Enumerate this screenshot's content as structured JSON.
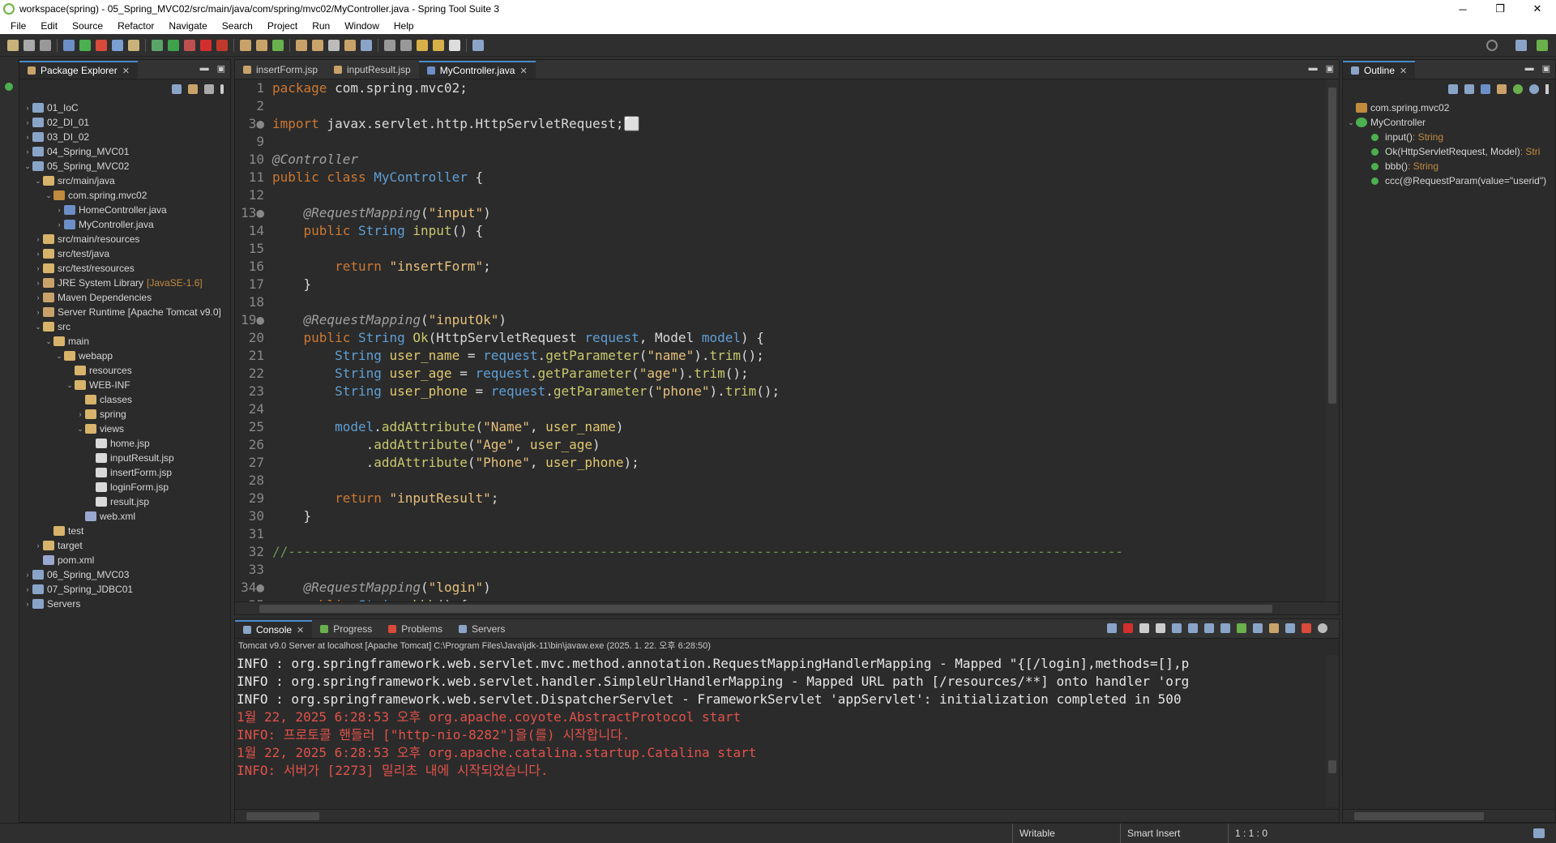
{
  "window": {
    "title": "workspace(spring) - 05_Spring_MVC02/src/main/java/com/spring/mvc02/MyController.java - Spring Tool Suite 3",
    "controls": [
      "─",
      "❐",
      "✕"
    ]
  },
  "menu": [
    "File",
    "Edit",
    "Source",
    "Refactor",
    "Navigate",
    "Search",
    "Project",
    "Run",
    "Window",
    "Help"
  ],
  "package_explorer": {
    "tab": "Package Explorer",
    "tree": [
      {
        "label": "01_IoC",
        "depth": 0,
        "arrow": "›",
        "color": "#8aa4c8"
      },
      {
        "label": "02_DI_01",
        "depth": 0,
        "arrow": "›",
        "color": "#8aa4c8"
      },
      {
        "label": "03_DI_02",
        "depth": 0,
        "arrow": "›",
        "color": "#8aa4c8"
      },
      {
        "label": "04_Spring_MVC01",
        "depth": 0,
        "arrow": "›",
        "color": "#8aa4c8"
      },
      {
        "label": "05_Spring_MVC02",
        "depth": 0,
        "arrow": "⌄",
        "color": "#8aa4c8"
      },
      {
        "label": "src/main/java",
        "depth": 1,
        "arrow": "⌄",
        "color": "#d7b36b"
      },
      {
        "label": "com.spring.mvc02",
        "depth": 2,
        "arrow": "⌄",
        "color": "#c08b3e"
      },
      {
        "label": "HomeController.java",
        "depth": 3,
        "arrow": "›",
        "color": "#6d8fc7"
      },
      {
        "label": "MyController.java",
        "depth": 3,
        "arrow": "›",
        "color": "#6d8fc7"
      },
      {
        "label": "src/main/resources",
        "depth": 1,
        "arrow": "›",
        "color": "#d7b36b"
      },
      {
        "label": "src/test/java",
        "depth": 1,
        "arrow": "›",
        "color": "#d7b36b"
      },
      {
        "label": "src/test/resources",
        "depth": 1,
        "arrow": "›",
        "color": "#d7b36b"
      },
      {
        "label": "JRE System Library",
        "deco": "[JavaSE-1.6]",
        "depth": 1,
        "arrow": "›",
        "color": "#c9a26a"
      },
      {
        "label": "Maven Dependencies",
        "depth": 1,
        "arrow": "›",
        "color": "#c9a26a"
      },
      {
        "label": "Server Runtime [Apache Tomcat v9.0]",
        "depth": 1,
        "arrow": "›",
        "color": "#c9a26a"
      },
      {
        "label": "src",
        "depth": 1,
        "arrow": "⌄",
        "color": "#d7b36b"
      },
      {
        "label": "main",
        "depth": 2,
        "arrow": "⌄",
        "color": "#d7b36b"
      },
      {
        "label": "webapp",
        "depth": 3,
        "arrow": "⌄",
        "color": "#d7b36b"
      },
      {
        "label": "resources",
        "depth": 4,
        "arrow": "",
        "color": "#d7b36b"
      },
      {
        "label": "WEB-INF",
        "depth": 4,
        "arrow": "⌄",
        "color": "#d7b36b"
      },
      {
        "label": "classes",
        "depth": 5,
        "arrow": "",
        "color": "#d7b36b"
      },
      {
        "label": "spring",
        "depth": 5,
        "arrow": "›",
        "color": "#d7b36b"
      },
      {
        "label": "views",
        "depth": 5,
        "arrow": "⌄",
        "color": "#d7b36b"
      },
      {
        "label": "home.jsp",
        "depth": 6,
        "arrow": "",
        "color": "#d9d9d9"
      },
      {
        "label": "inputResult.jsp",
        "depth": 6,
        "arrow": "",
        "color": "#d9d9d9"
      },
      {
        "label": "insertForm.jsp",
        "depth": 6,
        "arrow": "",
        "color": "#d9d9d9"
      },
      {
        "label": "loginForm.jsp",
        "depth": 6,
        "arrow": "",
        "color": "#d9d9d9"
      },
      {
        "label": "result.jsp",
        "depth": 6,
        "arrow": "",
        "color": "#d9d9d9"
      },
      {
        "label": "web.xml",
        "depth": 5,
        "arrow": "",
        "color": "#9aa7d0"
      },
      {
        "label": "test",
        "depth": 2,
        "arrow": "",
        "color": "#d7b36b"
      },
      {
        "label": "target",
        "depth": 1,
        "arrow": "›",
        "color": "#d7b36b"
      },
      {
        "label": "pom.xml",
        "depth": 1,
        "arrow": "",
        "color": "#9aa7d0"
      },
      {
        "label": "06_Spring_MVC03",
        "depth": 0,
        "arrow": "›",
        "color": "#8aa4c8"
      },
      {
        "label": "07_Spring_JDBC01",
        "depth": 0,
        "arrow": "›",
        "color": "#8aa4c8"
      },
      {
        "label": "Servers",
        "depth": 0,
        "arrow": "›",
        "color": "#8aa4c8"
      }
    ]
  },
  "editor": {
    "tabs": [
      {
        "label": "insertForm.jsp",
        "active": false
      },
      {
        "label": "inputResult.jsp",
        "active": false
      },
      {
        "label": "MyController.java",
        "active": true
      }
    ],
    "lines": [
      {
        "n": "1",
        "html": "<span class=\"kw\">package</span> com.spring.mvc02;"
      },
      {
        "n": "2",
        "html": ""
      },
      {
        "n": "3●",
        "html": "<span class=\"kw\">import</span> javax.servlet.http.HttpServletRequest;⬜"
      },
      {
        "n": "9",
        "html": ""
      },
      {
        "n": "10",
        "html": "<span class=\"ann\">@Controller</span>"
      },
      {
        "n": "11",
        "html": "<span class=\"kw\">public class</span> <span class=\"typ\">MyController</span> {"
      },
      {
        "n": "12",
        "html": ""
      },
      {
        "n": "13●",
        "html": "    <span class=\"ann\">@RequestMapping</span>(<span class=\"str\">\"input\"</span>)"
      },
      {
        "n": "14",
        "html": "    <span class=\"kw\">public</span> <span class=\"typ\">String</span> <span class=\"mth\">input</span>() {"
      },
      {
        "n": "15",
        "html": ""
      },
      {
        "n": "16",
        "html": "        <span class=\"kw\">return</span> <span class=\"str\">\"insertForm\"</span>;"
      },
      {
        "n": "17",
        "html": "    }"
      },
      {
        "n": "18",
        "html": ""
      },
      {
        "n": "19●",
        "html": "    <span class=\"ann\">@RequestMapping</span>(<span class=\"str\">\"inputOk\"</span>)"
      },
      {
        "n": "20",
        "html": "    <span class=\"kw\">public</span> <span class=\"typ\">String</span> <span class=\"mth\">Ok</span>(HttpServletRequest <span class=\"typ\">request</span>, Model <span class=\"typ\">model</span>) {"
      },
      {
        "n": "21",
        "html": "        <span class=\"typ\">String</span> <span class=\"var\">user_name</span> = <span class=\"typ\">request</span>.<span class=\"mth\">getParameter</span>(<span class=\"str\">\"name\"</span>).<span class=\"mth\">trim</span>();"
      },
      {
        "n": "22",
        "html": "        <span class=\"typ\">String</span> <span class=\"var\">user_age</span> = <span class=\"typ\">request</span>.<span class=\"mth\">getParameter</span>(<span class=\"str\">\"age\"</span>).<span class=\"mth\">trim</span>();"
      },
      {
        "n": "23",
        "html": "        <span class=\"typ\">String</span> <span class=\"var\">user_phone</span> = <span class=\"typ\">request</span>.<span class=\"mth\">getParameter</span>(<span class=\"str\">\"phone\"</span>).<span class=\"mth\">trim</span>();"
      },
      {
        "n": "24",
        "html": ""
      },
      {
        "n": "25",
        "html": "        <span class=\"typ\">model</span>.<span class=\"mth\">addAttribute</span>(<span class=\"str\">\"Name\"</span>, <span class=\"var\">user_name</span>)"
      },
      {
        "n": "26",
        "html": "            .<span class=\"mth\">addAttribute</span>(<span class=\"str\">\"Age\"</span>, <span class=\"var\">user_age</span>)"
      },
      {
        "n": "27",
        "html": "            .<span class=\"mth\">addAttribute</span>(<span class=\"str\">\"Phone\"</span>, <span class=\"var\">user_phone</span>);"
      },
      {
        "n": "28",
        "html": ""
      },
      {
        "n": "29",
        "html": "        <span class=\"kw\">return</span> <span class=\"str\">\"inputResult\"</span>;"
      },
      {
        "n": "30",
        "html": "    }"
      },
      {
        "n": "31",
        "html": ""
      },
      {
        "n": "32",
        "html": "<span class=\"cmt\">//-----------------------------------------------------------------------------------------------------------</span>"
      },
      {
        "n": "33",
        "html": ""
      },
      {
        "n": "34●",
        "html": "    <span class=\"ann\">@RequestMapping</span>(<span class=\"str\">\"login\"</span>)"
      },
      {
        "n": "35",
        "html": "    <span class=\"kw\">public</span> <span class=\"typ\">String</span> <span class=\"mth\">bbb</span>() {"
      }
    ]
  },
  "console": {
    "tabs": [
      {
        "label": "Console",
        "active": true
      },
      {
        "label": "Progress",
        "active": false
      },
      {
        "label": "Problems",
        "active": false
      },
      {
        "label": "Servers",
        "active": false
      }
    ],
    "info": "Tomcat v9.0 Server at localhost [Apache Tomcat] C:\\Program Files\\Java\\jdk-11\\bin\\javaw.exe  (2025. 1. 22. 오후 6:28:50)",
    "lines": [
      {
        "text": "INFO : org.springframework.web.servlet.mvc.method.annotation.RequestMappingHandlerMapping - Mapped \"{[/login],methods=[],p",
        "err": false
      },
      {
        "text": "INFO : org.springframework.web.servlet.handler.SimpleUrlHandlerMapping - Mapped URL path [/resources/**] onto handler 'org",
        "err": false
      },
      {
        "text": "INFO : org.springframework.web.servlet.DispatcherServlet - FrameworkServlet 'appServlet': initialization completed in 500",
        "err": false
      },
      {
        "text": "1월 22, 2025 6:28:53 오후 org.apache.coyote.AbstractProtocol start",
        "err": true
      },
      {
        "text": "INFO: 프로토콜 핸들러 [\"http-nio-8282\"]을(를) 시작합니다.",
        "err": true
      },
      {
        "text": "1월 22, 2025 6:28:53 오후 org.apache.catalina.startup.Catalina start",
        "err": true
      },
      {
        "text": "INFO: 서버가 [2273] 밀리초 내에 시작되었습니다.",
        "err": true
      }
    ]
  },
  "outline": {
    "tab": "Outline",
    "items": [
      {
        "label": "com.spring.mvc02",
        "depth": 0,
        "kind": "package"
      },
      {
        "label": "MyController",
        "depth": 0,
        "kind": "class"
      },
      {
        "label": "input()",
        "ret": " : String",
        "depth": 1,
        "kind": "method"
      },
      {
        "label": "Ok(HttpServletRequest, Model)",
        "ret": " : Stri",
        "depth": 1,
        "kind": "method"
      },
      {
        "label": "bbb()",
        "ret": " : String",
        "depth": 1,
        "kind": "method"
      },
      {
        "label": "ccc(@RequestParam(value=\"userid\")",
        "ret": "",
        "depth": 1,
        "kind": "method"
      }
    ]
  },
  "status": {
    "writable": "Writable",
    "insert_mode": "Smart Insert",
    "position": "1 : 1 : 0"
  }
}
